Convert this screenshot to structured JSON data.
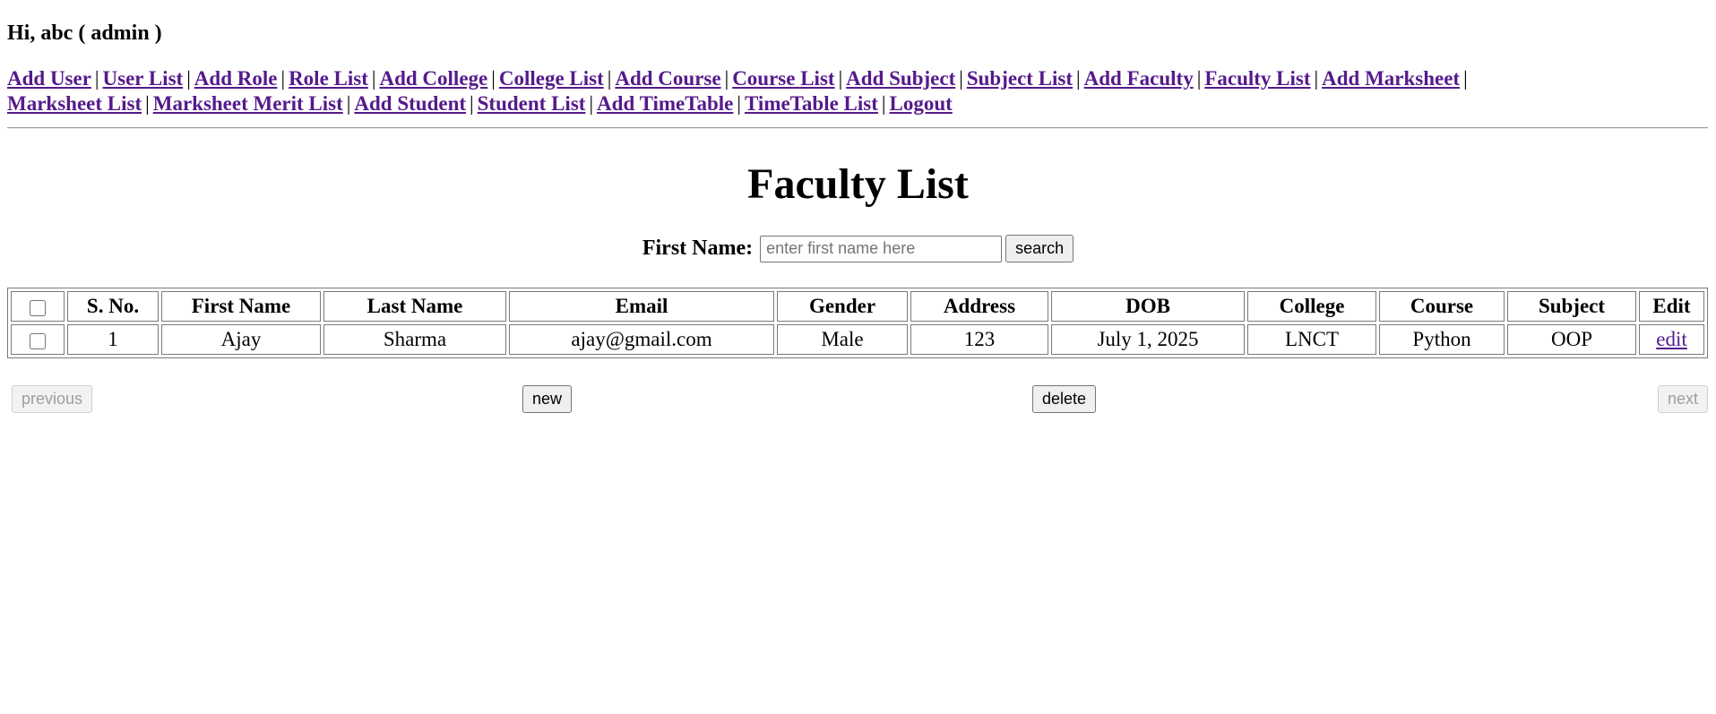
{
  "header": {
    "greeting": "Hi, abc ( admin )"
  },
  "nav": {
    "row1": [
      {
        "name": "add-user",
        "label": "Add User"
      },
      {
        "name": "user-list",
        "label": "User List"
      },
      {
        "name": "add-role",
        "label": "Add Role"
      },
      {
        "name": "role-list",
        "label": "Role List"
      },
      {
        "name": "add-college",
        "label": "Add College"
      },
      {
        "name": "college-list",
        "label": "College List"
      },
      {
        "name": "add-course",
        "label": "Add Course"
      },
      {
        "name": "course-list",
        "label": "Course List"
      },
      {
        "name": "add-subject",
        "label": "Add Subject"
      },
      {
        "name": "subject-list",
        "label": "Subject List"
      },
      {
        "name": "add-faculty",
        "label": "Add Faculty"
      },
      {
        "name": "faculty-list",
        "label": "Faculty List"
      },
      {
        "name": "add-marksheet",
        "label": "Add Marksheet"
      }
    ],
    "row2": [
      {
        "name": "marksheet-list",
        "label": "Marksheet List"
      },
      {
        "name": "marksheet-merit-list",
        "label": "Marksheet Merit List"
      },
      {
        "name": "add-student",
        "label": "Add Student"
      },
      {
        "name": "student-list",
        "label": "Student List"
      },
      {
        "name": "add-timetable",
        "label": "Add TimeTable"
      },
      {
        "name": "timetable-list",
        "label": "TimeTable List"
      },
      {
        "name": "logout",
        "label": "Logout"
      }
    ],
    "separator": "|"
  },
  "page": {
    "title": "Faculty List"
  },
  "search": {
    "label": "First Name:",
    "placeholder": "enter first name here",
    "value": "",
    "button_label": "search"
  },
  "table": {
    "columns": [
      "S. No.",
      "First Name",
      "Last Name",
      "Email",
      "Gender",
      "Address",
      "DOB",
      "College",
      "Course",
      "Subject",
      "Edit"
    ],
    "rows": [
      {
        "sno": "1",
        "first_name": "Ajay",
        "last_name": "Sharma",
        "email": "ajay@gmail.com",
        "gender": "Male",
        "address": "123",
        "dob": "July 1, 2025",
        "college": "LNCT",
        "course": "Python",
        "subject": "OOP",
        "edit_label": "edit"
      }
    ]
  },
  "pager": {
    "previous_label": "previous",
    "new_label": "new",
    "delete_label": "delete",
    "next_label": "next"
  }
}
